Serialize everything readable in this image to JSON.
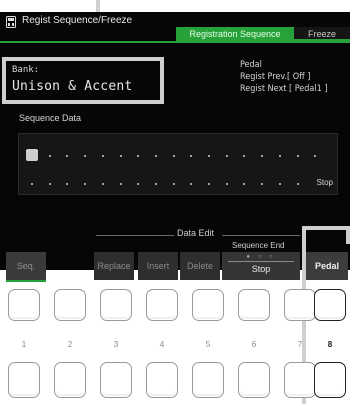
{
  "window": {
    "title": "Regist Sequence/Freeze"
  },
  "tabs": [
    {
      "label": "Registration Sequence",
      "active": true
    },
    {
      "label": "Freeze",
      "active": false
    }
  ],
  "bank": {
    "label": "Bank:",
    "name": "Unison & Accent"
  },
  "pedal_info": {
    "heading": "Pedal",
    "regist_prev": "Regist Prev.[ Off ]",
    "regist_next": "Regist Next [ Pedal1 ]"
  },
  "sequence": {
    "label": "Sequence Data",
    "end_marker": "Stop",
    "cursor_position": 1
  },
  "data_edit": {
    "group_label": "Data Edit",
    "replace_label": "Replace",
    "insert_label": "Insert",
    "delete_label": "Delete"
  },
  "sequence_end": {
    "group_label": "Sequence End",
    "value_label": "Stop",
    "indicator_dots": "● ○ ○"
  },
  "buttons": {
    "seq_label": "Seq.",
    "pedal_label": "Pedal"
  },
  "pads": {
    "numbers": [
      "1",
      "2",
      "3",
      "4",
      "5",
      "6",
      "7",
      "8"
    ]
  },
  "colors": {
    "accent_green": "#27a13a",
    "screen_bg": "#060606",
    "highlight_box": "#cfcfcf"
  }
}
